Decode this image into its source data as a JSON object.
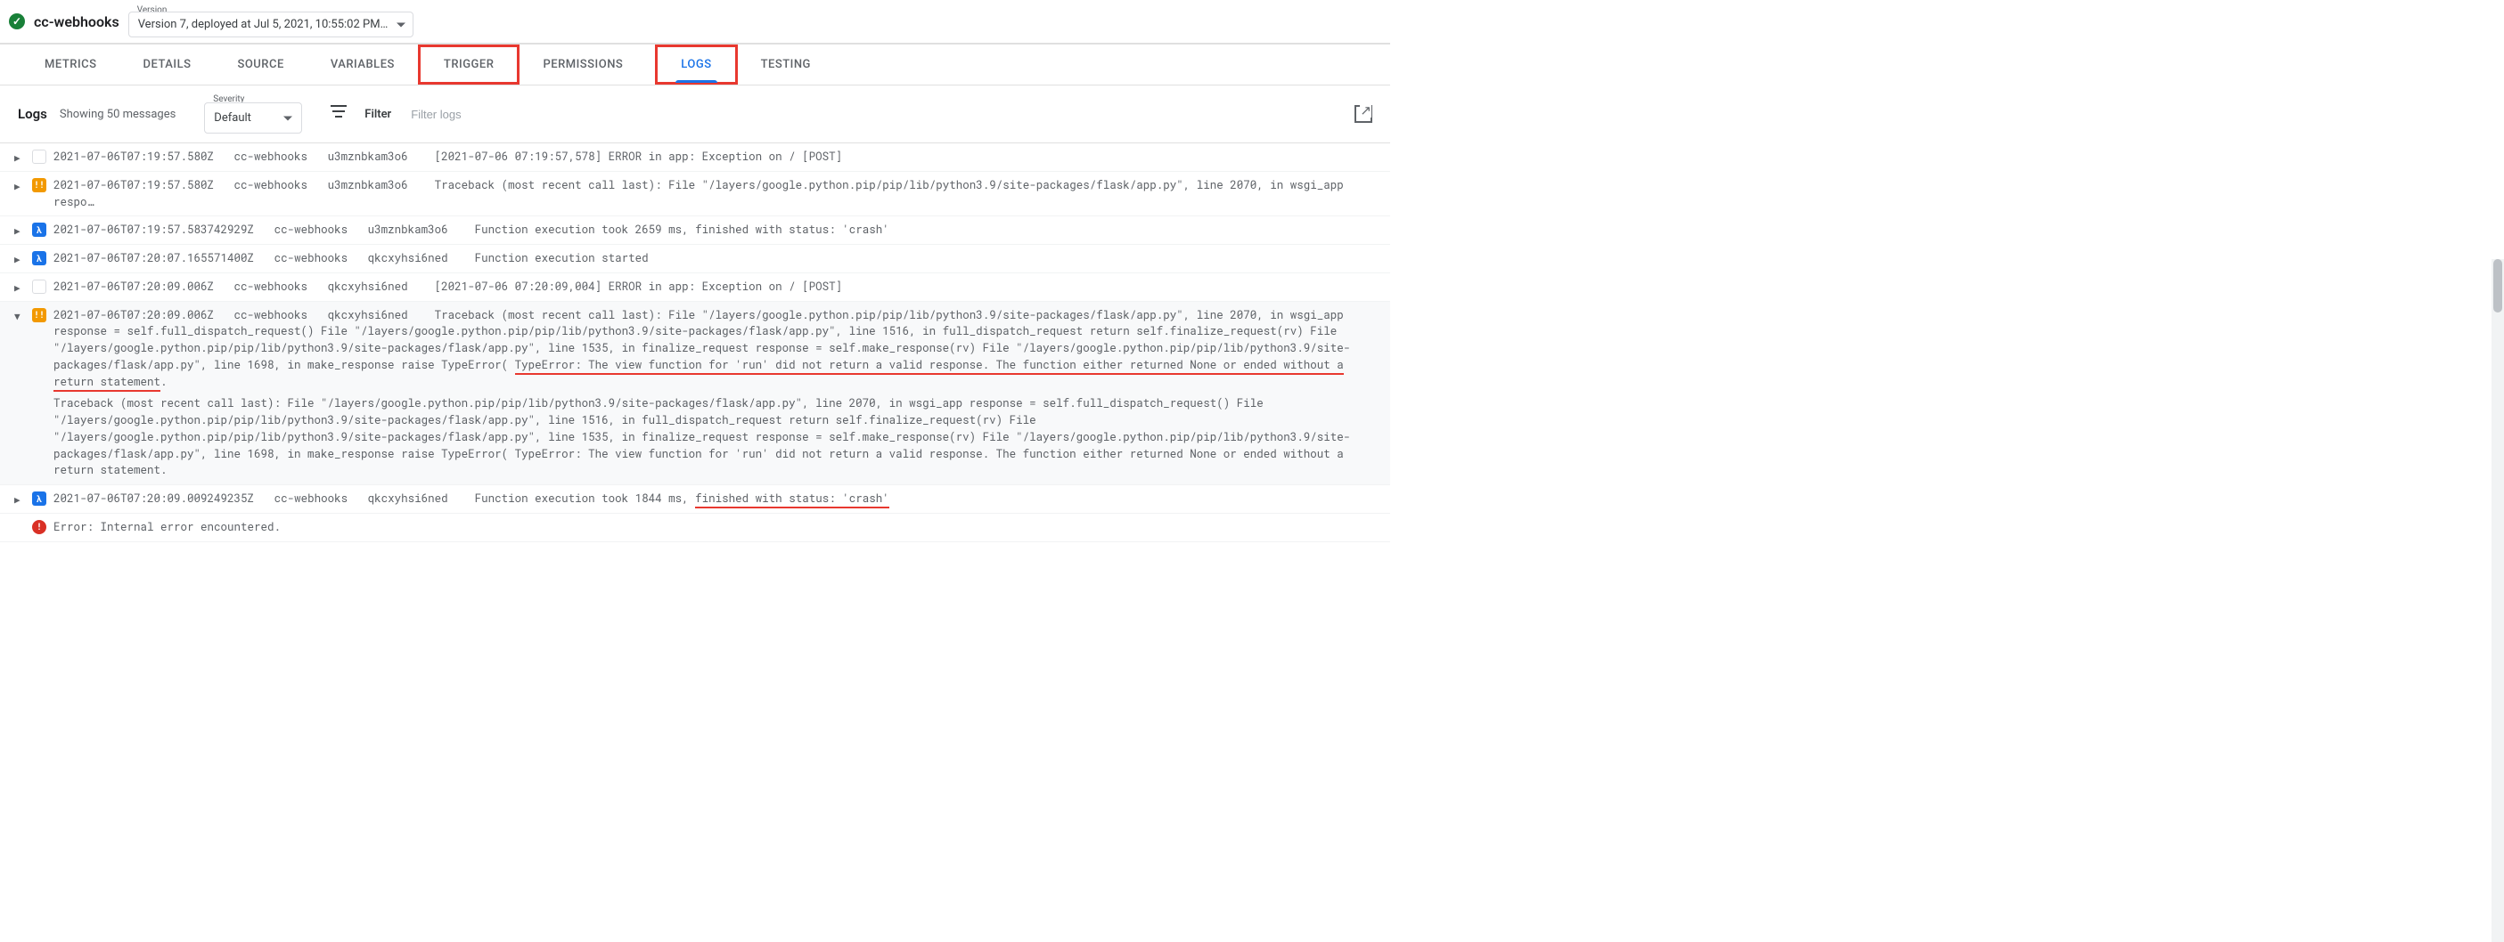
{
  "header": {
    "function_name": "cc-webhooks",
    "version_label": "Version",
    "version_text": "Version 7, deployed at Jul 5, 2021, 10:55:02 PM…"
  },
  "tabs": {
    "metrics": "METRICS",
    "details": "DETAILS",
    "source": "SOURCE",
    "variables": "VARIABLES",
    "trigger": "TRIGGER",
    "permissions": "PERMISSIONS",
    "logs": "LOGS",
    "testing": "TESTING"
  },
  "logsbar": {
    "title": "Logs",
    "subtitle": "Showing 50 messages",
    "severity_label": "Severity",
    "severity_value": "Default",
    "filter_label": "Filter",
    "filter_placeholder": "Filter logs"
  },
  "rows": [
    {
      "sev": "default",
      "ts": "2021-07-06T07:19:57.580Z",
      "svc": "cc-webhooks",
      "id": "u3mznbkam3o6",
      "msg": "[2021-07-06 07:19:57,578] ERROR in app: Exception on / [POST]"
    },
    {
      "sev": "error",
      "ts": "2021-07-06T07:19:57.580Z",
      "svc": "cc-webhooks",
      "id": "u3mznbkam3o6",
      "msg": "Traceback (most recent call last): File \"/layers/google.python.pip/pip/lib/python3.9/site-packages/flask/app.py\", line 2070, in wsgi_app respo…"
    },
    {
      "sev": "debug",
      "ts": "2021-07-06T07:19:57.583742929Z",
      "svc": "cc-webhooks",
      "id": "u3mznbkam3o6",
      "msg": "Function execution took 2659 ms, finished with status: 'crash'"
    },
    {
      "sev": "debug",
      "ts": "2021-07-06T07:20:07.165571400Z",
      "svc": "cc-webhooks",
      "id": "qkcxyhsi6ned",
      "msg": "Function execution started"
    },
    {
      "sev": "default",
      "ts": "2021-07-06T07:20:09.006Z",
      "svc": "cc-webhooks",
      "id": "qkcxyhsi6ned",
      "msg": "[2021-07-06 07:20:09,004] ERROR in app: Exception on / [POST]"
    }
  ],
  "expanded": {
    "sev": "error",
    "ts": "2021-07-06T07:20:09.006Z",
    "svc": "cc-webhooks",
    "id": "qkcxyhsi6ned",
    "msg_pre": "Traceback (most recent call last): File \"/layers/google.python.pip/pip/lib/python3.9/site-packages/flask/app.py\", line 2070, in wsgi_app response = self.full_dispatch_request() File \"/layers/google.python.pip/pip/lib/python3.9/site-packages/flask/app.py\", line 1516, in full_dispatch_request return self.finalize_request(rv) File \"/layers/google.python.pip/pip/lib/python3.9/site-packages/flask/app.py\", line 1535, in finalize_request response = self.make_response(rv) File \"/layers/google.python.pip/pip/lib/python3.9/site-packages/flask/app.py\", line 1698, in make_response raise TypeError( ",
    "msg_u1": "TypeError: The view function for 'run' did not return a valid response. The function either returned None or ended without a",
    "msg_u2": "return statement",
    "msg_post": ".",
    "trace": "Traceback (most recent call last): File \"/layers/google.python.pip/pip/lib/python3.9/site-packages/flask/app.py\", line 2070, in wsgi_app response = self.full_dispatch_request() File \"/layers/google.python.pip/pip/lib/python3.9/site-packages/flask/app.py\", line 1516, in full_dispatch_request return self.finalize_request(rv) File \"/layers/google.python.pip/pip/lib/python3.9/site-packages/flask/app.py\", line 1535, in finalize_request response = self.make_response(rv) File \"/layers/google.python.pip/pip/lib/python3.9/site-packages/flask/app.py\", line 1698, in make_response raise TypeError( TypeError: The view function for 'run' did not return a valid response. The function either returned None or ended without a return statement."
  },
  "after": {
    "sev": "debug",
    "ts": "2021-07-06T07:20:09.009249235Z",
    "svc": "cc-webhooks",
    "id": "qkcxyhsi6ned",
    "msg_pre": "Function execution took 1844 ms, ",
    "msg_u": "finished with status: 'crash'"
  },
  "errorline": {
    "msg": "Error: Internal error encountered."
  }
}
